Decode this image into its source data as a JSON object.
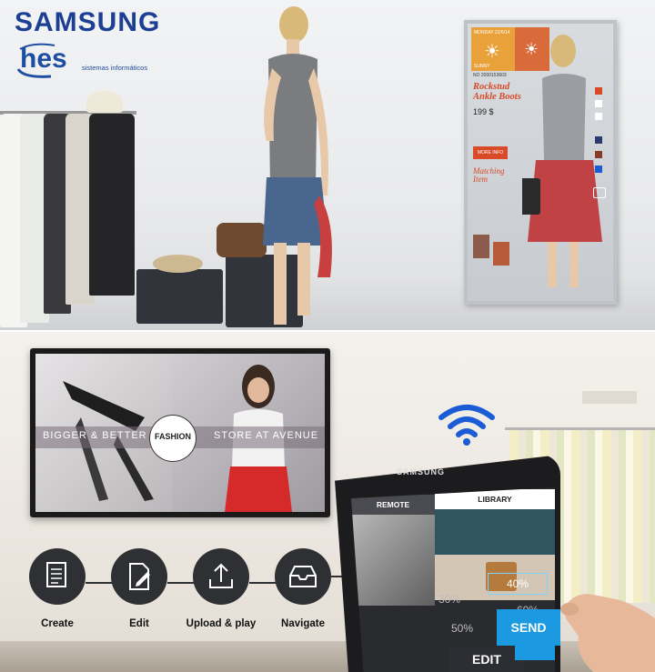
{
  "brand": {
    "samsung": "SAMSUNG",
    "hes": "hes",
    "hes_tagline": "sistemas informáticos"
  },
  "mirror": {
    "weather_label": "MONDAY 22/6/14",
    "sunny": "SUNNY",
    "product_no": "NO 2000153603",
    "product_title": "Rockstud Ankle Boots",
    "price": "199 $",
    "more_info": "MORE INFO",
    "matching": "Matching Item"
  },
  "tv": {
    "left_text": "BIGGER & BETTER",
    "badge": "FASHION",
    "right_text": "STORE AT AVENUE"
  },
  "phone": {
    "brand": "SAMSUNG",
    "tab_remote": "REMOTE",
    "tab_library": "LIBRARY",
    "pct_30": "30%",
    "pct_40": "40%",
    "pct_50": "50%",
    "pct_60": "60%",
    "edit": "EDIT",
    "send": "SEND"
  },
  "steps": [
    {
      "label": "Create",
      "icon": "document-icon"
    },
    {
      "label": "Edit",
      "icon": "edit-icon"
    },
    {
      "label": "Upload & play",
      "icon": "upload-icon"
    },
    {
      "label": "Navigate",
      "icon": "inbox-icon"
    }
  ],
  "colors": {
    "samsung_blue": "#1c3f94",
    "accent_orange": "#d84a28",
    "send_blue": "#1b9ae2",
    "wifi_blue": "#1a5bd6",
    "step_dark": "#2f3033"
  }
}
